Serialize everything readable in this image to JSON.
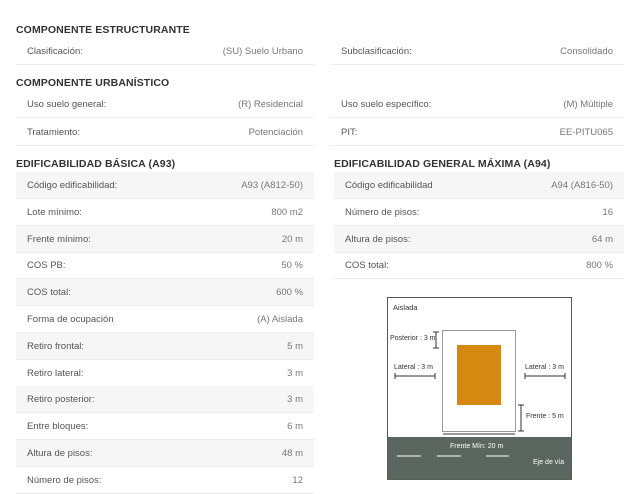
{
  "estructurante": {
    "title": "COMPONENTE ESTRUCTURANTE",
    "clasificacion_label": "Clasificación:",
    "clasificacion_value": "(SU) Suelo Urbano",
    "subclasificacion_label": "Subclasificación:",
    "subclasificacion_value": "Consolidado"
  },
  "urbanistico": {
    "title": "COMPONENTE URBANÍSTICO",
    "uso_general_label": "Uso suelo general:",
    "uso_general_value": "(R) Residencial",
    "uso_especifico_label": "Uso suelo específico:",
    "uso_especifico_value": "(M) Múltiple",
    "tratamiento_label": "Tratamiento:",
    "tratamiento_value": "Potenciación",
    "pit_label": "PIT:",
    "pit_value": "EE-PITU065"
  },
  "basica": {
    "title": "EDIFICABILIDAD BÁSICA (A93)",
    "rows": [
      {
        "label": "Código edificabilidad:",
        "value": "A93 (A812-50)"
      },
      {
        "label": "Lote mínimo:",
        "value": "800 m2"
      },
      {
        "label": "Frente mínimo:",
        "value": "20 m"
      },
      {
        "label": "COS PB:",
        "value": "50 %"
      },
      {
        "label": "COS total:",
        "value": "600 %"
      },
      {
        "label": "Forma de ocupación",
        "value": "(A) Aislada"
      },
      {
        "label": "Retiro frontal:",
        "value": "5 m"
      },
      {
        "label": "Retiro lateral:",
        "value": "3 m"
      },
      {
        "label": "Retiro posterior:",
        "value": "3 m"
      },
      {
        "label": "Entre bloques:",
        "value": "6 m"
      },
      {
        "label": "Altura de pisos:",
        "value": "48 m"
      },
      {
        "label": "Número de pisos:",
        "value": "12"
      }
    ]
  },
  "maxima": {
    "title": "EDIFICABILIDAD GENERAL MÁXIMA (A94)",
    "rows": [
      {
        "label": "Código edificabilidad",
        "value": "A94 (A816-50)"
      },
      {
        "label": "Número de pisos:",
        "value": "16"
      },
      {
        "label": "Altura de pisos:",
        "value": "64 m"
      },
      {
        "label": "COS total:",
        "value": "800 %"
      }
    ]
  },
  "diagram": {
    "title": "Aislada",
    "posterior": "Posterior : 3 m",
    "lateral_left": "Lateral : 3 m",
    "lateral_right": "Lateral : 3 m",
    "frente": "Frente : 5 m",
    "frente_min": "Frente Mín: 20 m",
    "eje_via": "Eje de vía",
    "building_color": "#d68910",
    "road_color": "#5c6660"
  }
}
